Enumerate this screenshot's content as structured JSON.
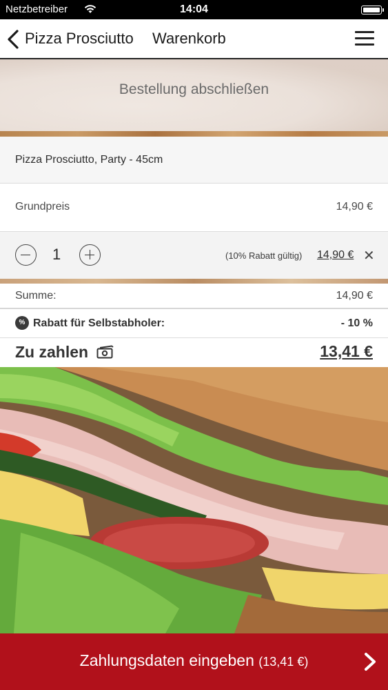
{
  "status_bar": {
    "carrier": "Netzbetreiber",
    "time": "14:04"
  },
  "nav": {
    "back_label": "Pizza Prosciutto",
    "title": "Warenkorb"
  },
  "header": {
    "heading": "Bestellung abschließen"
  },
  "item": {
    "name": "Pizza Prosciutto, Party - 45cm",
    "base_label": "Grundpreis",
    "base_price": "14,90 €",
    "quantity": "1",
    "discount_note": "(10% Rabatt gültig)",
    "line_price": "14,90 €",
    "remove_glyph": "✕"
  },
  "summary": {
    "sum_label": "Summe:",
    "sum_value": "14,90 €",
    "discount_badge": "%",
    "discount_label": "Rabatt für Selbstabholer:",
    "discount_value": "- 10 %",
    "total_label": "Zu zahlen",
    "total_value": "13,41 €"
  },
  "cta": {
    "label": "Zahlungsdaten eingeben",
    "amount": "(13,41 €)"
  },
  "colors": {
    "cta_background": "#b1111b",
    "nav_border": "#222222"
  },
  "icons": [
    "wifi-icon",
    "battery-icon",
    "back-chevron-icon",
    "menu-icon",
    "minus-icon",
    "plus-icon",
    "close-icon",
    "discount-badge-icon",
    "money-icon",
    "chevron-right-icon"
  ]
}
